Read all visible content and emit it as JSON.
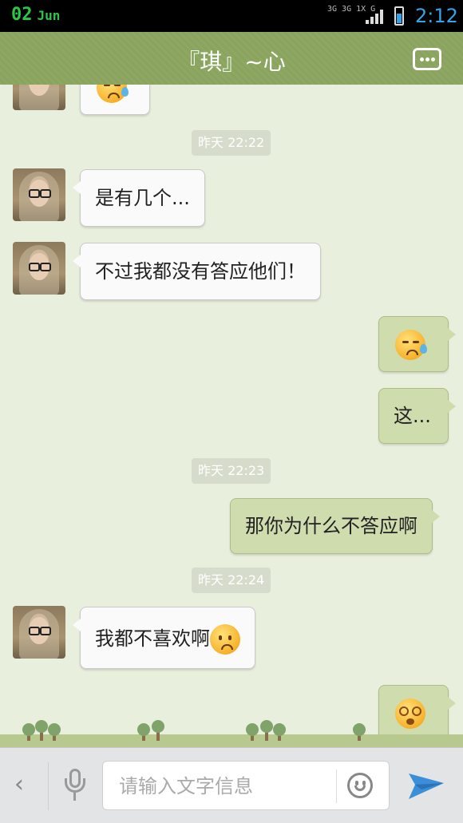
{
  "status_bar": {
    "date_day": "02",
    "date_month": "Jun",
    "network": "3G 3G 1X G",
    "time": "2:12",
    "battery_level": 0.62,
    "signal_bars": 4
  },
  "header": {
    "title": "『琪』~心",
    "more_icon": "more-dots-icon"
  },
  "messages": {
    "m0": {
      "side": "left",
      "type": "emoji",
      "emoji": "sweat-emoji"
    },
    "t1": "昨天 22:22",
    "m1": {
      "side": "left",
      "text": "是有几个..."
    },
    "m2": {
      "side": "left",
      "text": "不过我都没有答应他们！"
    },
    "m3": {
      "side": "right",
      "type": "emoji",
      "emoji": "sweat-emoji"
    },
    "m4": {
      "side": "right",
      "text": "这..."
    },
    "t2": "昨天 22:23",
    "m5": {
      "side": "right",
      "text": "那你为什么不答应啊"
    },
    "t3": "昨天 22:24",
    "m6": {
      "side": "left",
      "text": "我都不喜欢啊",
      "emoji": "sad-emoji"
    },
    "m7": {
      "side": "right",
      "type": "emoji",
      "emoji": "dizzy-emoji"
    }
  },
  "input_bar": {
    "placeholder": "请输入文字信息",
    "icons": [
      "back-chevron-icon",
      "microphone-icon",
      "smiley-icon",
      "send-icon"
    ]
  },
  "colors": {
    "header": "#8aa35f",
    "chat_background": "#e9efdd",
    "outgoing_bubble": "#cfdcae",
    "incoming_bubble": "#fafafa",
    "time_accent": "#2fa6e8"
  }
}
